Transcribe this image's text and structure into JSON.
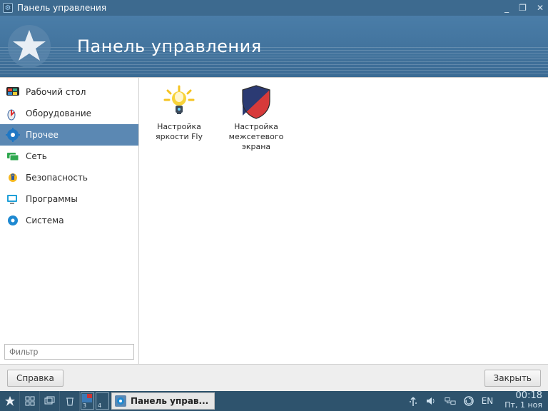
{
  "window": {
    "title": "Панель управления",
    "header_title": "Панель управления"
  },
  "sidebar": {
    "items": [
      {
        "label": "Рабочий стол",
        "icon": "desktop-icon"
      },
      {
        "label": "Оборудование",
        "icon": "hardware-icon"
      },
      {
        "label": "Прочее",
        "icon": "gear-icon",
        "active": true
      },
      {
        "label": "Сеть",
        "icon": "network-icon"
      },
      {
        "label": "Безопасность",
        "icon": "security-icon"
      },
      {
        "label": "Программы",
        "icon": "programs-icon"
      },
      {
        "label": "Система",
        "icon": "system-gear-icon"
      }
    ],
    "filter_placeholder": "Фильтр"
  },
  "main": {
    "launchers": [
      {
        "label": "Настройка яркости Fly",
        "icon": "brightness-icon"
      },
      {
        "label": "Настройка межсетевого экрана",
        "icon": "shield-icon"
      }
    ]
  },
  "buttons": {
    "help": "Справка",
    "close": "Закрыть"
  },
  "taskbar": {
    "active_task": "Панель управ...",
    "lang": "EN",
    "pager": [
      "3",
      "4"
    ],
    "clock_time": "00:18",
    "clock_date": "Пт, 1 ноя"
  }
}
